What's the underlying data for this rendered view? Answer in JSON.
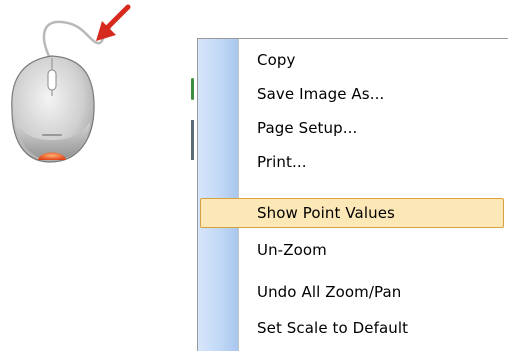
{
  "context_menu": {
    "items": [
      {
        "label": "Copy",
        "highlighted": false
      },
      {
        "label": "Save Image As...",
        "highlighted": false
      },
      {
        "label": "Page Setup...",
        "highlighted": false
      },
      {
        "label": "Print...",
        "highlighted": false
      },
      {
        "label": "Show Point Values",
        "highlighted": true
      },
      {
        "label": "Un-Zoom",
        "highlighted": false
      },
      {
        "label": "Undo All Zoom/Pan",
        "highlighted": false
      },
      {
        "label": "Set Scale to Default",
        "highlighted": false
      }
    ]
  },
  "colors": {
    "gutter": "#c2d8f6",
    "highlight_fill": "#fce7b6",
    "highlight_border": "#d9a240",
    "arrow": "#d62a1e",
    "mouse_button": "#e8541c"
  },
  "icons": {
    "mouse": "computer-mouse-icon",
    "arrow": "pointer-arrow-icon"
  }
}
